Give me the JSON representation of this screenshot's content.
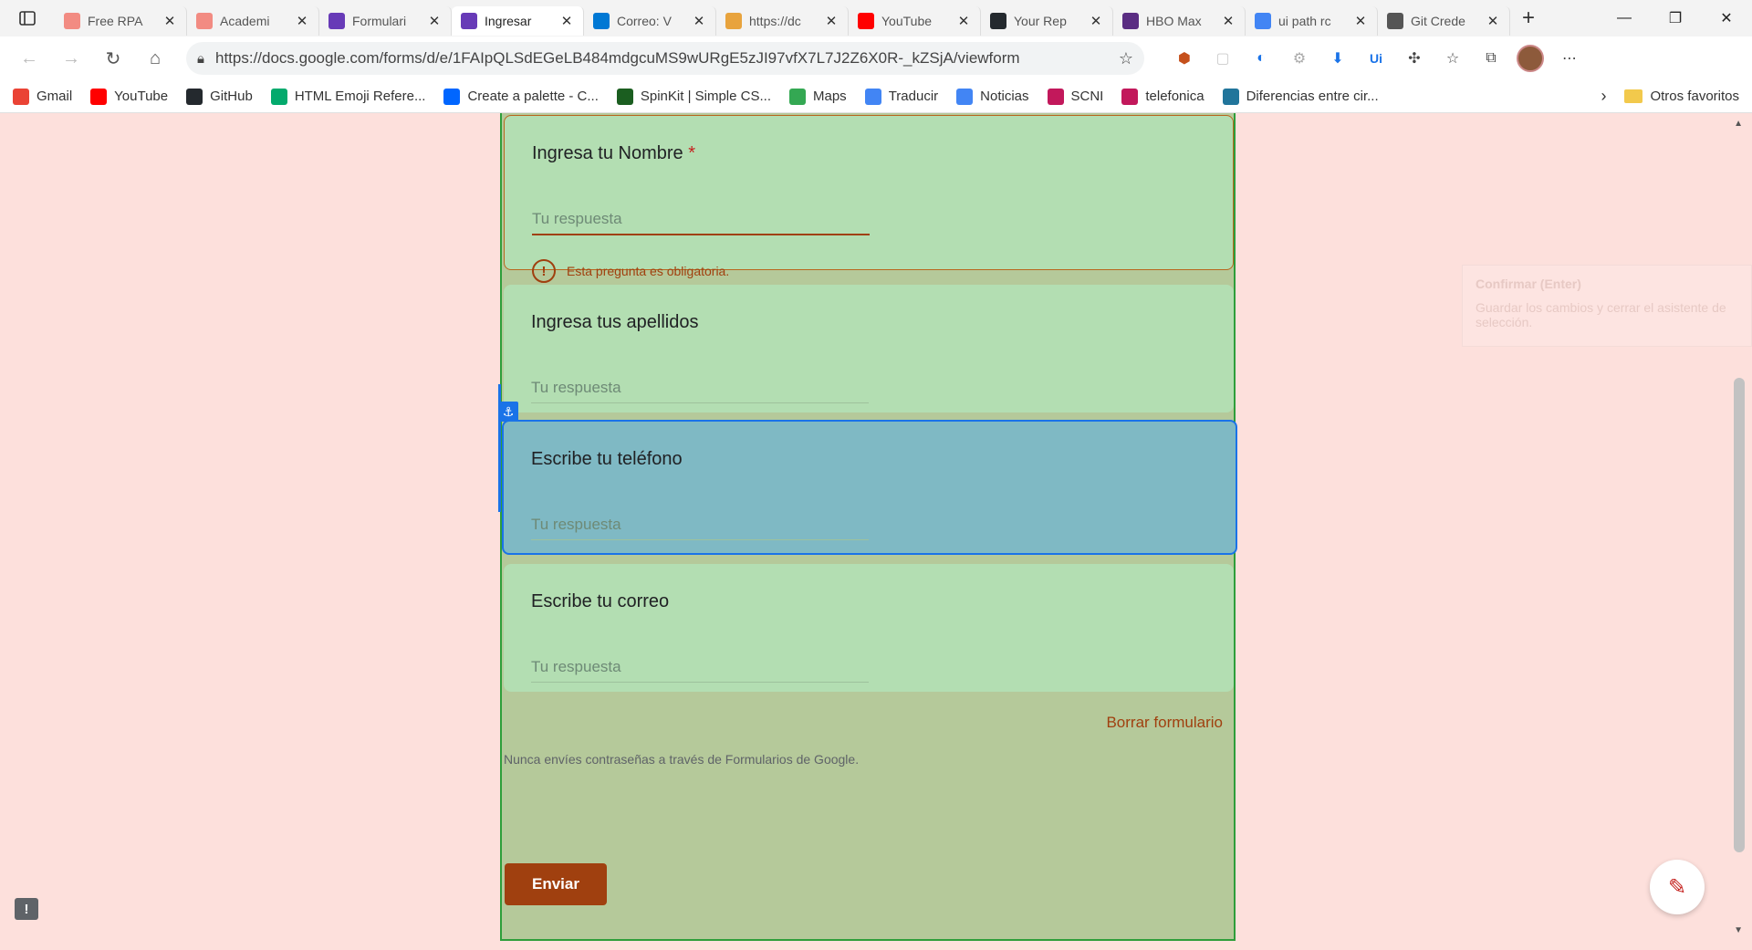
{
  "browser": {
    "tabs": [
      {
        "title": "Free RPA",
        "icon": "uipath-icon",
        "color": "#f28b82",
        "active": false
      },
      {
        "title": "Academi",
        "icon": "uipath-icon",
        "color": "#f28b82",
        "active": false
      },
      {
        "title": "Formulari",
        "icon": "google-forms-icon",
        "color": "#673ab7",
        "active": false
      },
      {
        "title": "Ingresar",
        "icon": "google-forms-icon",
        "color": "#673ab7",
        "active": true
      },
      {
        "title": "Correo: V",
        "icon": "outlook-icon",
        "color": "#0078d4",
        "active": false
      },
      {
        "title": "https://dc",
        "icon": "uipath-icon",
        "color": "#e8a33d",
        "active": false
      },
      {
        "title": "YouTube",
        "icon": "youtube-icon",
        "color": "#ff0000",
        "active": false
      },
      {
        "title": "Your Rep",
        "icon": "github-icon",
        "color": "#24292e",
        "active": false
      },
      {
        "title": "HBO Max",
        "icon": "hbo-max-icon",
        "color": "#5a2d82",
        "active": false
      },
      {
        "title": "ui path rc",
        "icon": "google-icon",
        "color": "#4285f4",
        "active": false
      },
      {
        "title": "Git Crede",
        "icon": "document-icon",
        "color": "#555555",
        "active": false
      }
    ],
    "url": "https://docs.google.com/forms/d/e/1FAIpQLSdEGeLB484mdgcuMS9wURgE5zJI97vfX7L7J2Z6X0R-_kZSjA/viewform",
    "bookmarks": [
      {
        "label": "Gmail",
        "icon": "gmail-icon",
        "color": "#ea4335"
      },
      {
        "label": "YouTube",
        "icon": "youtube-icon",
        "color": "#ff0000"
      },
      {
        "label": "GitHub",
        "icon": "github-icon",
        "color": "#24292e"
      },
      {
        "label": "HTML Emoji Refere...",
        "icon": "w3schools-icon",
        "color": "#04aa6d"
      },
      {
        "label": "Create a palette - C...",
        "icon": "coolors-icon",
        "color": "#0066ff"
      },
      {
        "label": "SpinKit | Simple CS...",
        "icon": "spinkit-icon",
        "color": "#1b5e20"
      },
      {
        "label": "Maps",
        "icon": "maps-icon",
        "color": "#34a853"
      },
      {
        "label": "Traducir",
        "icon": "translate-icon",
        "color": "#4285f4"
      },
      {
        "label": "Noticias",
        "icon": "news-icon",
        "color": "#4285f4"
      },
      {
        "label": "SCNI",
        "icon": "scni-icon",
        "color": "#c2185b"
      },
      {
        "label": "telefonica",
        "icon": "scni-icon",
        "color": "#c2185b"
      },
      {
        "label": "Diferencias entre cir...",
        "icon": "wordpress-icon",
        "color": "#21759b"
      }
    ],
    "other_favorites": "Otros favoritos"
  },
  "form": {
    "questions": [
      {
        "title": "Ingresa tu Nombre",
        "required": true,
        "required_mark": "*",
        "placeholder": "Tu respuesta",
        "error": "Esta pregunta es obligatoria."
      },
      {
        "title": "Ingresa tus apellidos",
        "required": false,
        "placeholder": "Tu respuesta"
      },
      {
        "title": "Escribe tu teléfono",
        "required": false,
        "placeholder": "Tu respuesta",
        "highlighted": true
      },
      {
        "title": "Escribe tu correo",
        "required": false,
        "placeholder": "Tu respuesta"
      }
    ],
    "submit_label": "Enviar",
    "clear_label": "Borrar formulario",
    "notice": "Nunca envíes contraseñas a través de Formularios de Google."
  },
  "tooltip": {
    "title": "Confirmar (Enter)",
    "body": "Guardar los cambios y cerrar el asistente de selección."
  },
  "colors": {
    "accent": "#a0400f",
    "selection": "#1a73e8",
    "form_bg": "#b5c99a",
    "card_bg": "#b3deb2",
    "page_bg": "#fde0dc"
  }
}
